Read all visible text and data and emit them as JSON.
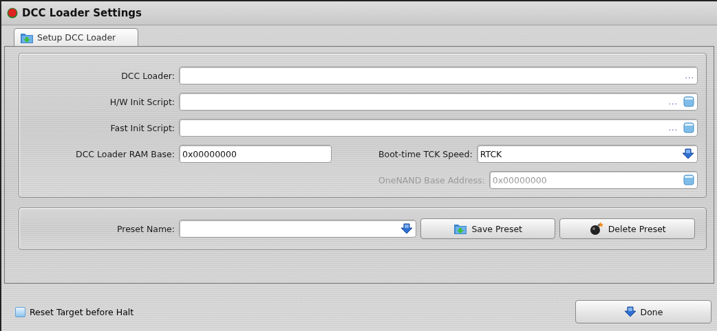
{
  "window": {
    "title": "DCC Loader Settings"
  },
  "tabs": [
    {
      "label": "Setup DCC Loader",
      "selected": true
    }
  ],
  "settings": {
    "rows": [
      {
        "fields": [
          {
            "kind": "browse",
            "label": "DCC Loader:",
            "button": "...",
            "disabled": false
          }
        ]
      },
      {
        "fields": [
          {
            "kind": "script",
            "label": "H/W Init Script:",
            "button": "...",
            "disabled": false
          }
        ]
      },
      {
        "fields": [
          {
            "kind": "script",
            "label": "Fast Init Script:",
            "button": "...",
            "disabled": false
          }
        ]
      },
      {
        "fields": [
          {
            "kind": "text",
            "label": "DCC Loader RAM Base:",
            "value": "0x00000000",
            "disabled": false
          },
          {
            "kind": "combo",
            "label": "Boot-time TCK Speed:",
            "value": "RTCK",
            "disabled": false
          }
        ]
      },
      {
        "fields": [
          {
            "kind": "address",
            "label": "OneNAND Base Address:",
            "value": "0x00000000",
            "disabled": true
          }
        ]
      }
    ]
  },
  "preset": {
    "label": "Preset Name:",
    "buttons": [
      {
        "kind": "save",
        "label": "Save Preset"
      },
      {
        "kind": "delete",
        "label": "Delete Preset"
      }
    ]
  },
  "footer": {
    "checkbox": {
      "label": "Reset Target before Halt",
      "checked": false
    },
    "done": {
      "label": "Done"
    }
  }
}
